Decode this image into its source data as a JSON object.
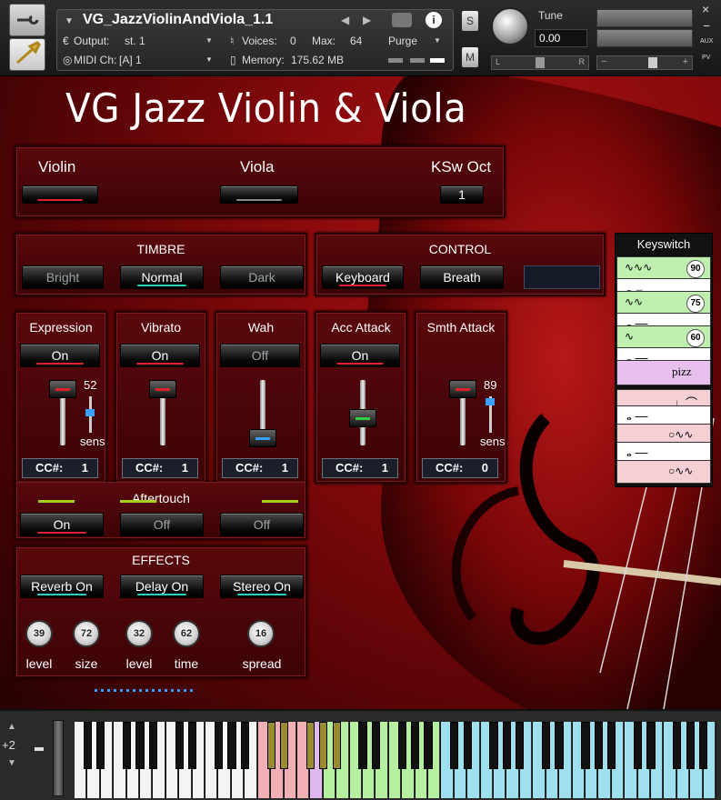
{
  "header": {
    "instrument_name": "VG_JazzViolinAndViola_1.1",
    "output_label": "Output:",
    "output_value": "st. 1",
    "voices_label": "Voices:",
    "voices_value": "0",
    "max_label": "Max:",
    "max_value": "64",
    "purge_label": "Purge",
    "midi_label": "MIDI Ch:",
    "midi_value": "[A]  1",
    "memory_label": "Memory:",
    "memory_value": "175.62 MB",
    "s_label": "S",
    "m_label": "M",
    "tune_label": "Tune",
    "tune_value": "0.00",
    "pan_left": "L",
    "pan_right": "R",
    "vol_minus": "−",
    "vol_plus": "+",
    "close_label": "×",
    "minimize_label": "−",
    "aux_label": "AUX",
    "pv_label": "PV"
  },
  "title": "VG Jazz Violin & Viola",
  "instrument_select": {
    "violin": "Violin",
    "viola": "Viola",
    "ksw_oct_label": "KSw Oct",
    "ksw_oct_value": "1"
  },
  "timbre": {
    "title": "TIMBRE",
    "bright": "Bright",
    "normal": "Normal",
    "dark": "Dark"
  },
  "control": {
    "title": "CONTROL",
    "keyboard": "Keyboard",
    "breath": "Breath"
  },
  "modules": [
    {
      "title": "Expression",
      "state": "On",
      "value": "52",
      "sens": "sens",
      "cc_label": "CC#:",
      "cc": "1"
    },
    {
      "title": "Vibrato",
      "state": "On",
      "cc_label": "CC#:",
      "cc": "1"
    },
    {
      "title": "Wah",
      "state": "Off",
      "cc_label": "CC#:",
      "cc": "1"
    },
    {
      "title": "Acc Attack",
      "state": "On",
      "cc_label": "CC#:",
      "cc": "1"
    },
    {
      "title": "Smth Attack",
      "value": "89",
      "sens": "sens",
      "cc_label": "CC#:",
      "cc": "0"
    }
  ],
  "aftertouch": {
    "title": "Aftertouch",
    "b1": "On",
    "b2": "Off",
    "b3": "Off"
  },
  "effects": {
    "title": "EFFECTS",
    "reverb": "Reverb On",
    "delay": "Delay On",
    "stereo": "Stereo On",
    "knobs": [
      {
        "value": "39",
        "label": "level"
      },
      {
        "value": "72",
        "label": "size"
      },
      {
        "value": "32",
        "label": "level"
      },
      {
        "value": "62",
        "label": "time"
      },
      {
        "value": "16",
        "label": "spread"
      }
    ]
  },
  "keyswitch": {
    "title": "Keyswitch",
    "n1": "90",
    "n2": "75",
    "n3": "60",
    "pizz": "pizz"
  },
  "keyboard": {
    "octave": "+2"
  },
  "colors": {
    "accent_red": "#e0202a",
    "accent_teal": "#2ad0c0",
    "accent_blue": "#3aa0ff",
    "accent_green": "#30d040",
    "key_blue": "#9fe0ee",
    "key_pink": "#f2b0b6",
    "key_green": "#b4f0a0",
    "key_purple": "#e0b8f0"
  }
}
